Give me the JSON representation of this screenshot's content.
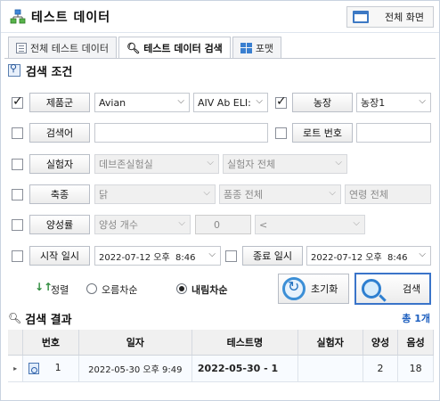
{
  "window": {
    "title": "테스트 데이터",
    "fullscreen_label": "전체 화면"
  },
  "tabs": [
    {
      "label": "전체 테스트 데이터",
      "icon": "document-list-icon",
      "active": false
    },
    {
      "label": "테스트 데이터 검색",
      "icon": "search-icon",
      "active": true
    },
    {
      "label": "포맷",
      "icon": "grid-icon",
      "active": false
    }
  ],
  "conditions": {
    "header": "검색 조건",
    "product_group": {
      "label": "제품군",
      "checked": true,
      "value": "Avian",
      "sub_value": "AIV Ab ELI:"
    },
    "farm": {
      "label": "농장",
      "checked": true,
      "value": "농장1"
    },
    "search_word": {
      "label": "검색어",
      "checked": false,
      "value": ""
    },
    "lot_no": {
      "label": "로트 번호",
      "checked": false,
      "value": ""
    },
    "tester": {
      "label": "실험자",
      "checked": false,
      "value": "데브존실험실",
      "sub_value": "실험자 전체"
    },
    "livestock": {
      "label": "축종",
      "checked": false,
      "value": "닭",
      "breed": "품종 전체",
      "age": "연령 전체"
    },
    "positive_rate": {
      "label": "양성률",
      "checked": false,
      "value": "양성 개수",
      "count": "0",
      "operator": "<"
    },
    "start_time": {
      "label": "시작 일시",
      "checked": false,
      "value": "2022-07-12 오후  8:46"
    },
    "end_time": {
      "label": "종료 일시",
      "checked": false,
      "value": "2022-07-12 오후  8:46"
    },
    "sort": {
      "label": "정렬",
      "ascending": "오름차순",
      "descending": "내림차순",
      "selected": "descending"
    },
    "reset_label": "초기화",
    "search_label": "검색"
  },
  "results": {
    "header": "검색 결과",
    "total": "총 1개",
    "columns": [
      "번호",
      "일자",
      "테스트명",
      "실험자",
      "양성",
      "음성"
    ],
    "rows": [
      {
        "no": "1",
        "date": "2022-05-30 오후 9:49",
        "name": "2022-05-30 - 1",
        "tester": "",
        "positive": "2",
        "negative": "18"
      }
    ]
  }
}
